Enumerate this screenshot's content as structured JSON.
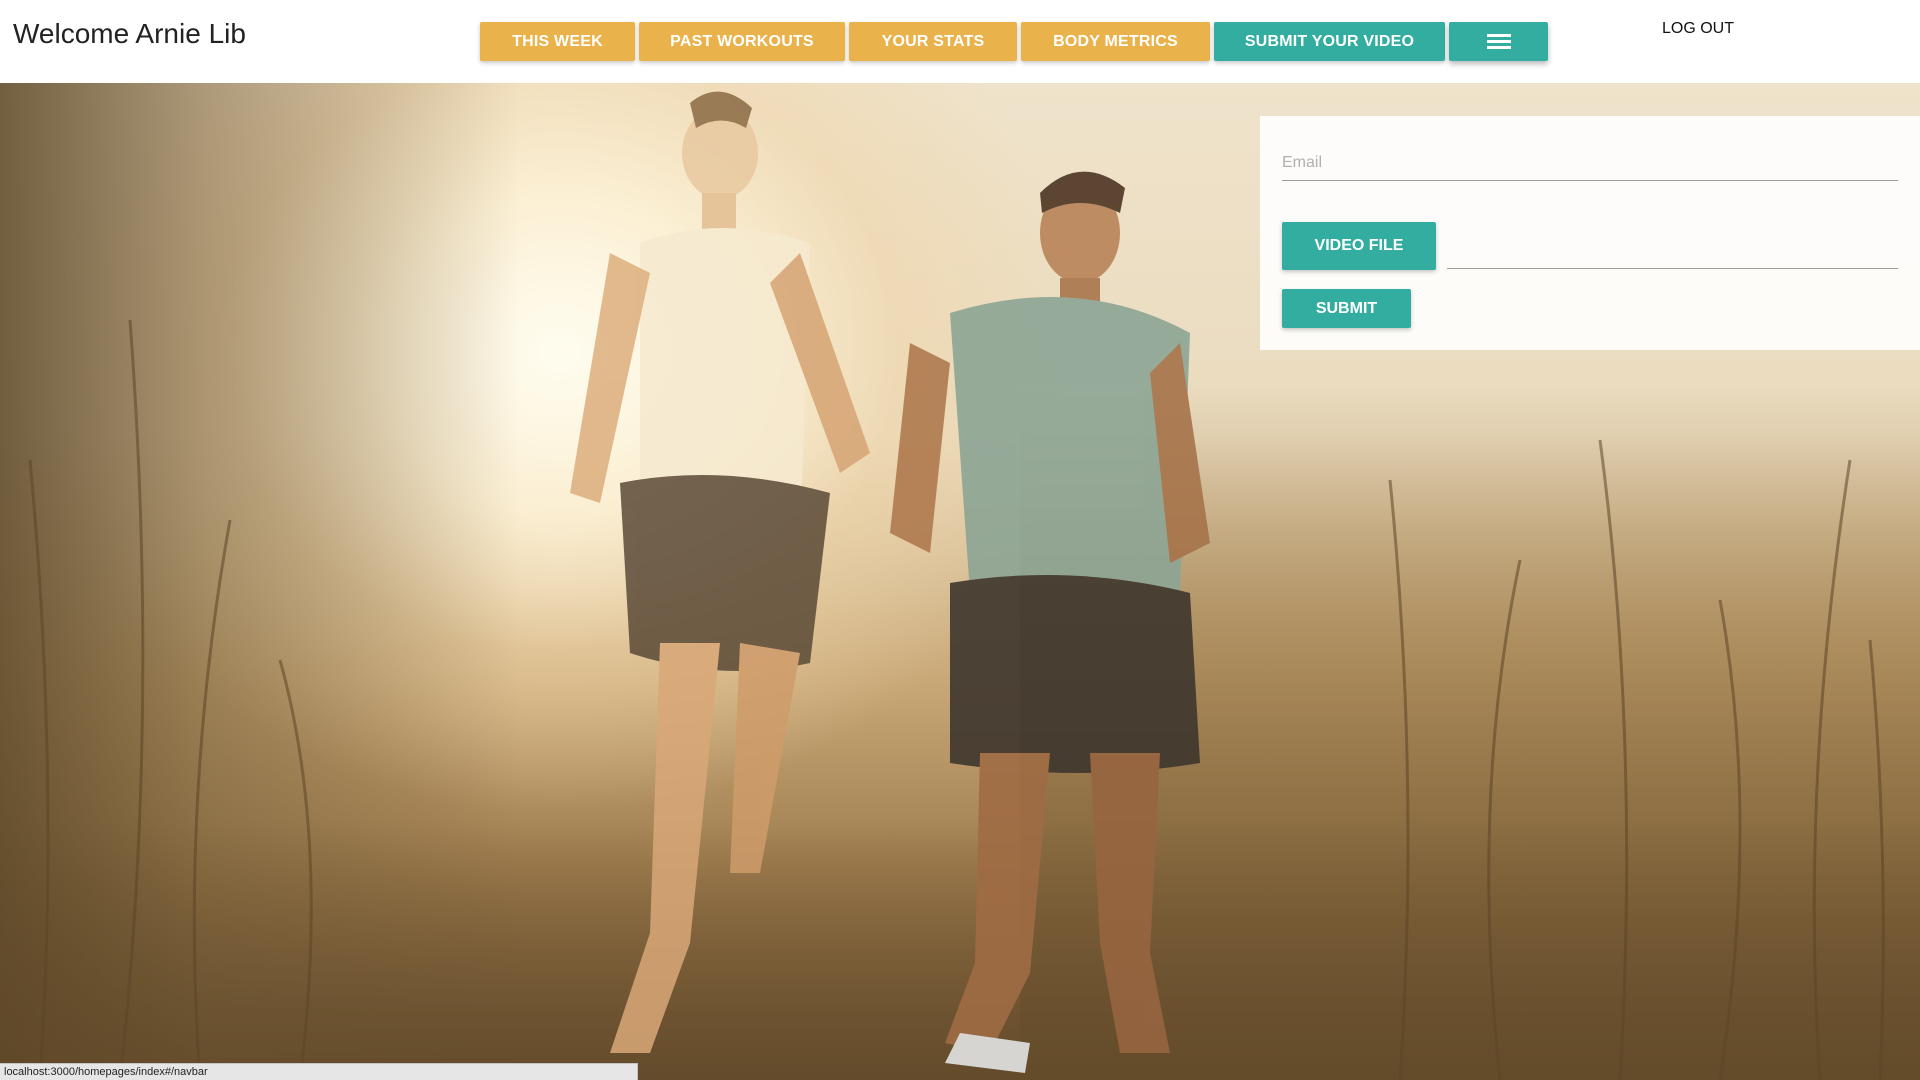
{
  "header": {
    "welcome_text": "Welcome Arnie Lib",
    "logout_label": "LOG OUT"
  },
  "nav": {
    "items": [
      {
        "label": "THIS WEEK",
        "style": "orange"
      },
      {
        "label": "PAST WORKOUTS",
        "style": "orange"
      },
      {
        "label": "YOUR STATS",
        "style": "orange"
      },
      {
        "label": "BODY METRICS",
        "style": "orange"
      },
      {
        "label": "SUBMIT YOUR VIDEO",
        "style": "teal"
      }
    ],
    "menu_icon": "hamburger-menu-icon"
  },
  "form": {
    "email_placeholder": "Email",
    "email_value": "",
    "video_file_label": "VIDEO FILE",
    "file_path_value": "",
    "submit_label": "SUBMIT"
  },
  "status_bar": {
    "url": "localhost:3000/homepages/index#/navbar"
  },
  "colors": {
    "accent_orange": "#e9b24a",
    "accent_teal": "#32ada0",
    "text_dark": "#222222"
  }
}
